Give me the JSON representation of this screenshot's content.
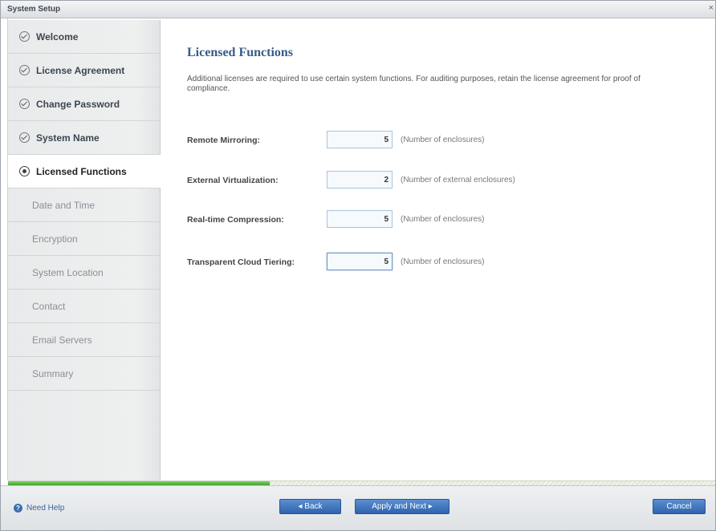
{
  "window": {
    "title": "System Setup",
    "close_glyph": "×"
  },
  "sidebar": {
    "steps": [
      {
        "label": "Welcome",
        "state": "done"
      },
      {
        "label": "License Agreement",
        "state": "done"
      },
      {
        "label": "Change Password",
        "state": "done"
      },
      {
        "label": "System Name",
        "state": "done"
      },
      {
        "label": "Licensed Functions",
        "state": "active"
      },
      {
        "label": "Date and Time",
        "state": "pending"
      },
      {
        "label": "Encryption",
        "state": "pending"
      },
      {
        "label": "System Location",
        "state": "pending"
      },
      {
        "label": "Contact",
        "state": "pending"
      },
      {
        "label": "Email Servers",
        "state": "pending"
      },
      {
        "label": "Summary",
        "state": "pending"
      }
    ]
  },
  "main": {
    "heading": "Licensed Functions",
    "description": "Additional licenses are required to use certain system functions. For auditing purposes, retain the license agreement for proof of compliance.",
    "fields": [
      {
        "label": "Remote Mirroring:",
        "value": "5",
        "hint": "(Number of enclosures)"
      },
      {
        "label": "External Virtualization:",
        "value": "2",
        "hint": "(Number of external enclosures)"
      },
      {
        "label": "Real-time Compression:",
        "value": "5",
        "hint": "(Number of enclosures)"
      },
      {
        "label": "Transparent Cloud Tiering:",
        "value": "5",
        "hint": "(Number of enclosures)"
      }
    ]
  },
  "progress": {
    "fraction": 0.37,
    "color": "#3fa52a"
  },
  "footer": {
    "help_label": "Need Help",
    "back_label": "◂ Back",
    "next_label": "Apply and Next ▸",
    "cancel_label": "Cancel"
  },
  "colors": {
    "accent": "#3a5a86",
    "button": "#2f63ad"
  }
}
